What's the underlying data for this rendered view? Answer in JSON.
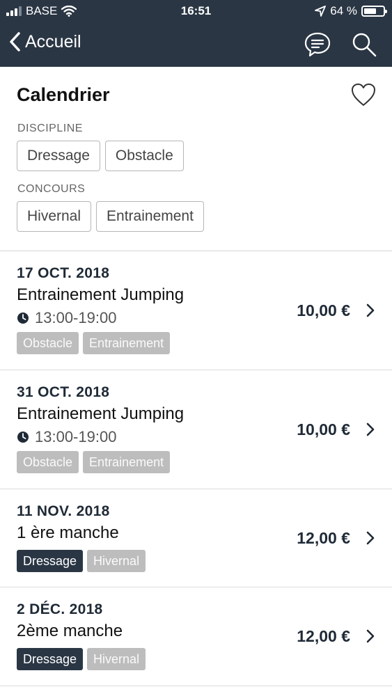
{
  "status_bar": {
    "carrier": "BASE",
    "time": "16:51",
    "battery": "64 %",
    "battery_level": 0.64
  },
  "nav": {
    "back_label": "Accueil",
    "chat_icon": "chat-bubble-icon",
    "search_icon": "search-icon"
  },
  "page": {
    "title": "Calendrier",
    "favorite_icon": "heart-icon"
  },
  "filters": {
    "discipline": {
      "label": "DISCIPLINE",
      "options": [
        "Dressage",
        "Obstacle"
      ]
    },
    "concours": {
      "label": "CONCOURS",
      "options": [
        "Hivernal",
        "Entrainement"
      ]
    }
  },
  "events": [
    {
      "date": "17 OCT. 2018",
      "name": "Entrainement Jumping",
      "time": "13:00-19:00",
      "price": "10,00 €",
      "tags": [
        "Obstacle",
        "Entrainement"
      ]
    },
    {
      "date": "31 OCT. 2018",
      "name": "Entrainement Jumping",
      "time": "13:00-19:00",
      "price": "10,00 €",
      "tags": [
        "Obstacle",
        "Entrainement"
      ]
    },
    {
      "date": "11 NOV. 2018",
      "name": "1 ère manche",
      "price": "12,00 €",
      "tags": [
        "Dressage",
        "Hivernal"
      ]
    },
    {
      "date": "2 DÉC. 2018",
      "name": "2ème manche",
      "price": "12,00 €",
      "tags": [
        "Dressage",
        "Hivernal"
      ]
    }
  ],
  "colors": {
    "header": "#2a3644",
    "tag_grey": "#bdbdbd",
    "tag_dark": "#2a3644"
  }
}
